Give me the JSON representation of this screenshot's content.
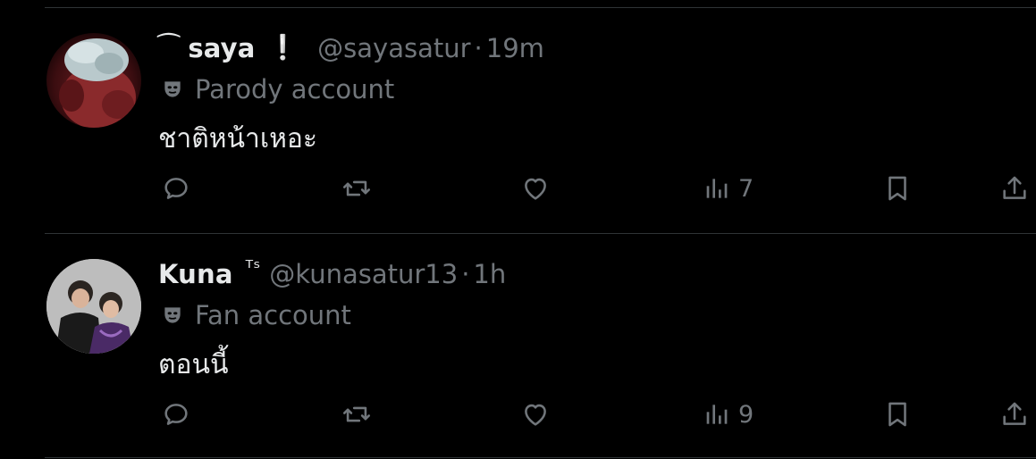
{
  "tweets": [
    {
      "name_decoration": "⁀",
      "display_name": "saya",
      "badge": "❕",
      "handle": "@sayasatur",
      "separator": "·",
      "time": "19m",
      "account_label": "Parody account",
      "text": "ชาติหน้าเหอะ",
      "views": "7"
    },
    {
      "display_name": "Kuna",
      "badge": "ᵀˢ",
      "handle": "@kunasatur13",
      "separator": "·",
      "time": "1h",
      "account_label": "Fan account",
      "text": "ตอนนี้",
      "views": "9"
    }
  ],
  "colors": {
    "background": "#000000",
    "primary_text": "#e7e9ea",
    "secondary_text": "#71767b",
    "divider": "#2f3336"
  },
  "icons": [
    "reply-icon",
    "retweet-icon",
    "like-icon",
    "views-icon",
    "bookmark-icon",
    "share-icon",
    "mask-icon"
  ]
}
